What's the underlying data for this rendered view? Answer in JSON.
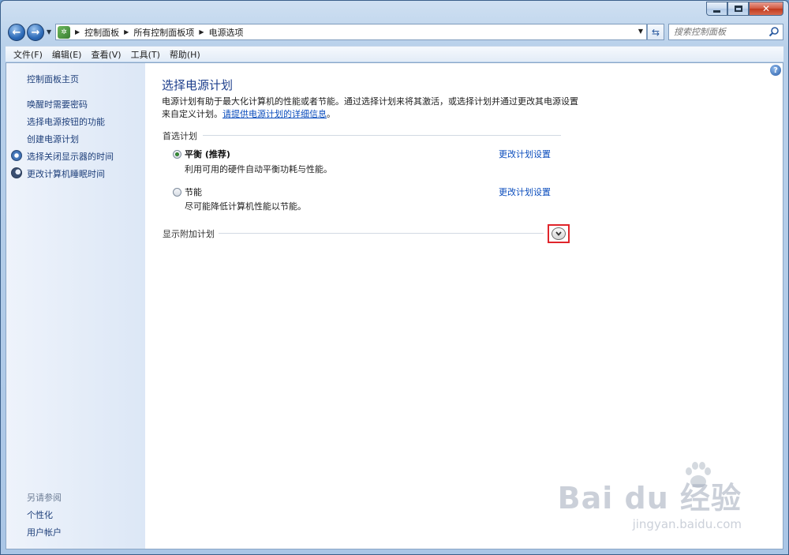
{
  "window": {
    "controls": {
      "close_glyph": "✕"
    }
  },
  "addressbar": {
    "back_glyph": "←",
    "forward_glyph": "→",
    "breadcrumbs": [
      "控制面板",
      "所有控制面板项",
      "电源选项"
    ],
    "search_placeholder": "搜索控制面板",
    "icons": [
      "control-panel-icon",
      "refresh-icon",
      "search-icon"
    ]
  },
  "menubar": {
    "items": [
      "文件(F)",
      "编辑(E)",
      "查看(V)",
      "工具(T)",
      "帮助(H)"
    ]
  },
  "sidebar": {
    "home": "控制面板主页",
    "links": [
      "唤醒时需要密码",
      "选择电源按钮的功能",
      "创建电源计划",
      "选择关闭显示器的时间",
      "更改计算机睡眠时间"
    ],
    "see_also_heading": "另请参阅",
    "see_also": [
      "个性化",
      "用户帐户"
    ]
  },
  "main": {
    "title": "选择电源计划",
    "description_line1": "电源计划有助于最大化计算机的性能或者节能。通过选择计划来将其激活，或选择计划并通过更改其电源设置",
    "description_line2_prefix": "来自定义计划。",
    "description_link": "请提供电源计划的详细信息",
    "description_suffix": "。",
    "preferred_group": "首选计划",
    "plans": [
      {
        "name": "平衡 (推荐)",
        "desc": "利用可用的硬件自动平衡功耗与性能。",
        "link": "更改计划设置",
        "selected": true
      },
      {
        "name": "节能",
        "desc": "尽可能降低计算机性能以节能。",
        "link": "更改计划设置",
        "selected": false
      }
    ],
    "additional_group": "显示附加计划",
    "highlight_color": "#e0252b"
  },
  "watermark": {
    "logo": "Bai du 经验",
    "url": "jingyan.baidu.com"
  }
}
